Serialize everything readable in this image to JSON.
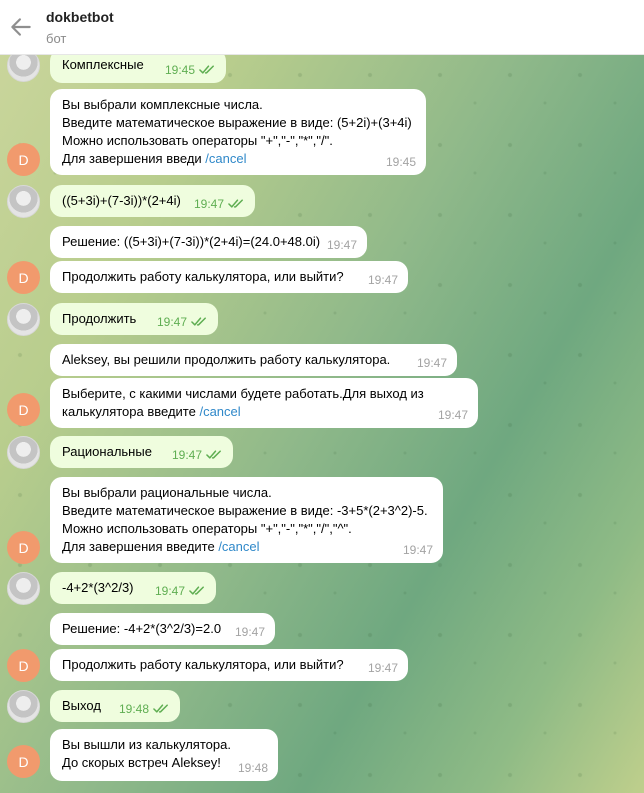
{
  "header": {
    "title": "dokbetbot",
    "subtitle": "бот"
  },
  "avatar_letter": "D",
  "colors": {
    "incoming": "#ffffff",
    "outgoing": "#effdde",
    "accent": "#f19a6d",
    "link": "#2f88c9",
    "check": "#5fae52"
  },
  "messages": [
    {
      "dir": "out",
      "lines": [
        "Комплексные"
      ],
      "time": "19:45"
    },
    {
      "dir": "in",
      "lines": [
        "Вы выбрали комплексные числа.",
        "Введите математическое выражение в виде: (5+2i)+(3+4i)",
        "Можно использовать операторы \"+\",\"-\",\"*\",\"/\"."
      ],
      "last_prefix": "Для завершения введи ",
      "link": "/cancel",
      "time": "19:45"
    },
    {
      "dir": "out",
      "lines": [
        "((5+3i)+(7-3i))*(2+4i)"
      ],
      "time": "19:47"
    },
    {
      "dir": "in",
      "lines": [
        "Решение: ((5+3i)+(7-3i))*(2+4i)=(24.0+48.0i)"
      ],
      "time": "19:47"
    },
    {
      "dir": "in",
      "lines": [
        "Продолжить работу калькулятора, или выйти?"
      ],
      "time": "19:47"
    },
    {
      "dir": "out",
      "lines": [
        "Продолжить"
      ],
      "time": "19:47"
    },
    {
      "dir": "in",
      "lines": [
        "Aleksey, вы решили продолжить работу калькулятора."
      ],
      "time": "19:47"
    },
    {
      "dir": "in",
      "lines": [
        "Выберите, с какими числами будете работать.Для выход из"
      ],
      "last_prefix": "калькулятора введите ",
      "link": "/cancel",
      "time": "19:47"
    },
    {
      "dir": "out",
      "lines": [
        "Рациональные"
      ],
      "time": "19:47"
    },
    {
      "dir": "in",
      "lines": [
        "Вы выбрали рациональные числа.",
        "Введите математическое выражение в виде: -3+5*(2+3^2)-5.",
        "Можно использовать операторы \"+\",\"-\",\"*\",\"/\",\"^\"."
      ],
      "last_prefix": "Для завершения введите ",
      "link": "/cancel",
      "time": "19:47"
    },
    {
      "dir": "out",
      "lines": [
        "-4+2*(3^2/3)"
      ],
      "time": "19:47"
    },
    {
      "dir": "in",
      "lines": [
        "Решение: -4+2*(3^2/3)=2.0"
      ],
      "time": "19:47"
    },
    {
      "dir": "in",
      "lines": [
        "Продолжить работу калькулятора, или выйти?"
      ],
      "time": "19:47"
    },
    {
      "dir": "out",
      "lines": [
        "Выход"
      ],
      "time": "19:48"
    },
    {
      "dir": "in",
      "lines": [
        "Вы вышли из калькулятора.",
        "До скорых встреч Aleksey!"
      ],
      "time": "19:48"
    }
  ]
}
